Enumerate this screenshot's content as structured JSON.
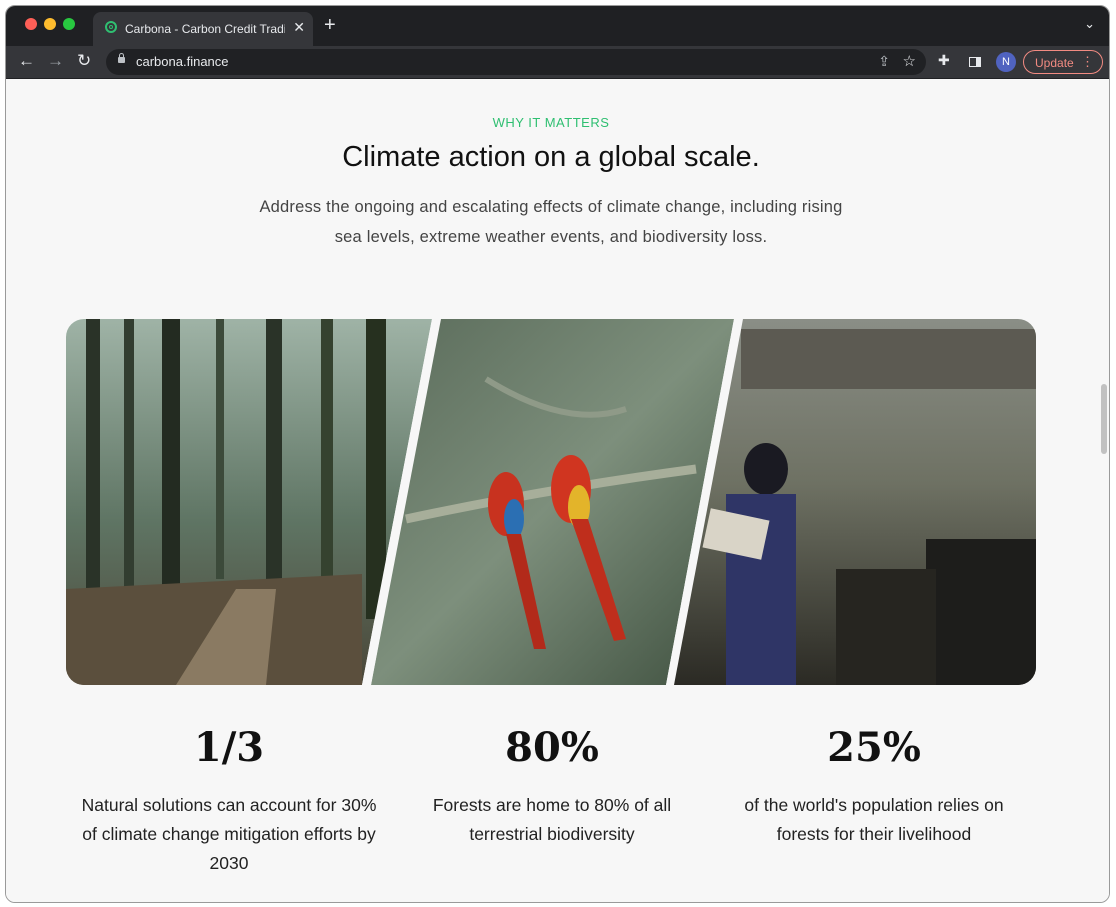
{
  "browser": {
    "tab_title": "Carbona - Carbon Credit Tradi",
    "url": "carbona.finance",
    "update_label": "Update",
    "avatar_initial": "N"
  },
  "section": {
    "eyebrow": "WHY IT MATTERS",
    "headline": "Climate action on a global scale.",
    "subtitle": "Address the ongoing and escalating effects of climate change, including rising sea levels, extreme weather events, and biodiversity loss."
  },
  "stats": [
    {
      "value": "1/3",
      "description": "Natural solutions can account for 30% of climate change mitigation efforts by 2030"
    },
    {
      "value": "80%",
      "description": "Forests are home to 80% of all terrestrial biodiversity"
    },
    {
      "value": "25%",
      "description": "of the world's population relies on forests for their livelihood"
    }
  ],
  "colors": {
    "accent": "#2fbf71",
    "update": "#f28b82"
  }
}
